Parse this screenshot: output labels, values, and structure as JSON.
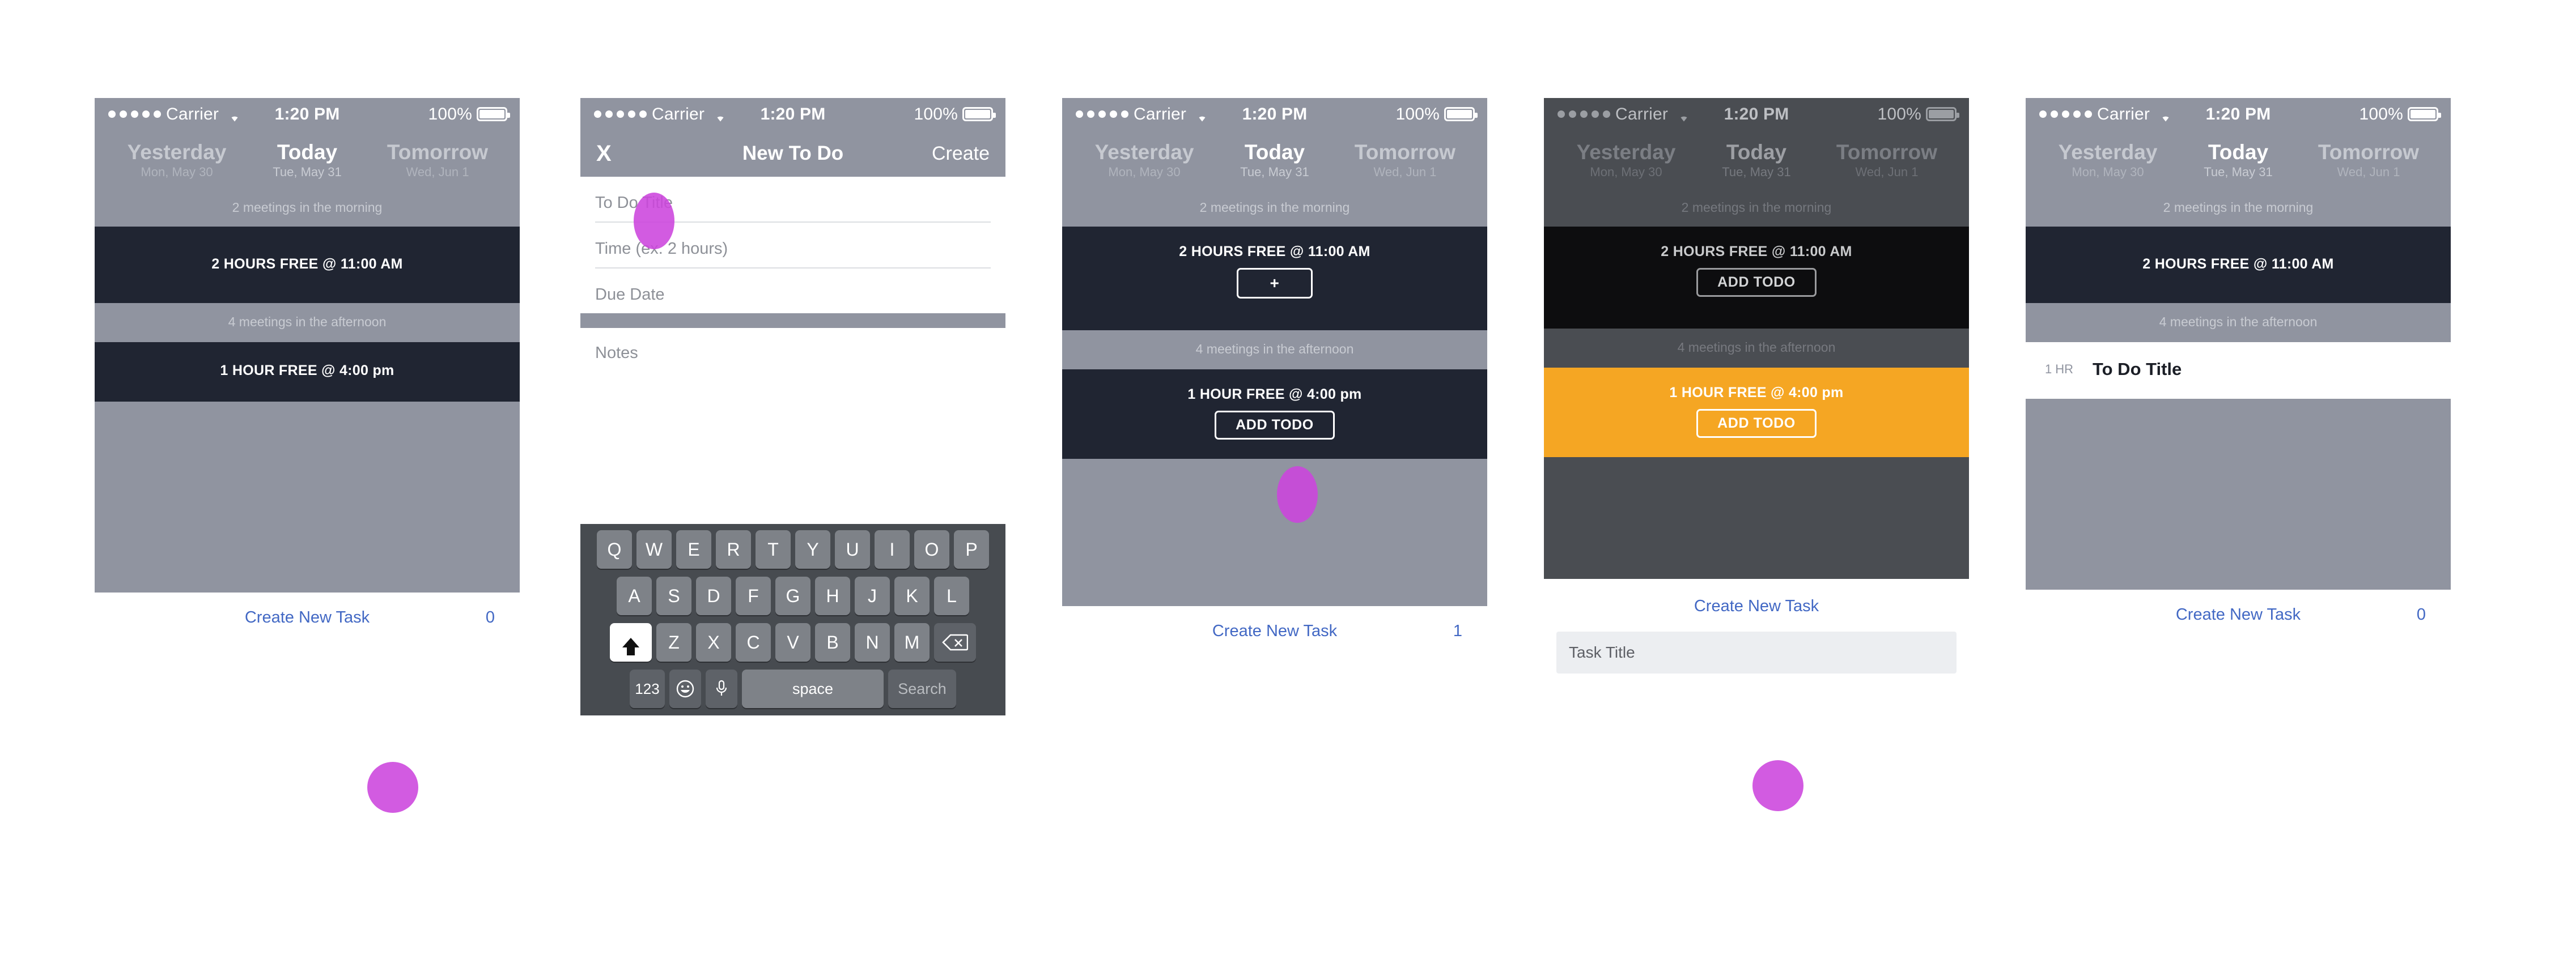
{
  "status_bar": {
    "carrier": "Carrier",
    "signal_dots": 5,
    "wifi_icon": "wifi-icon",
    "time": "1:20 PM",
    "battery_percent": "100%",
    "battery_icon": "battery-full-icon"
  },
  "days": [
    {
      "name": "Yesterday",
      "sub": "Mon, May 30",
      "active": false
    },
    {
      "name": "Today",
      "sub": "Tue, May 31",
      "active": true
    },
    {
      "name": "Tomorrow",
      "sub": "Wed, Jun 1",
      "active": false
    }
  ],
  "schedule": {
    "morning_summary": "2 meetings in the morning",
    "afternoon_summary": "4 meetings in the afternoon",
    "morning_free": "2 HOURS FREE @ 11:00 AM",
    "afternoon_free": "1 HOUR FREE @ 4:00 pm"
  },
  "buttons": {
    "add_todo": "ADD TODO",
    "plus": "+",
    "create_new_task": "Create New Task"
  },
  "counts": {
    "zero": "0",
    "one": "1"
  },
  "screen2": {
    "nav": {
      "close_icon": "close-icon",
      "close_label": "X",
      "title": "New To Do",
      "action": "Create"
    },
    "fields": [
      {
        "placeholder": "To Do Title"
      },
      {
        "placeholder": "Time (ex. 2 hours)"
      },
      {
        "placeholder": "Due Date"
      }
    ],
    "notes_placeholder": "Notes",
    "keyboard": {
      "row1": [
        "Q",
        "W",
        "E",
        "R",
        "T",
        "Y",
        "U",
        "I",
        "O",
        "P"
      ],
      "row2": [
        "A",
        "S",
        "D",
        "F",
        "G",
        "H",
        "J",
        "K",
        "L"
      ],
      "row3": [
        "Z",
        "X",
        "C",
        "V",
        "B",
        "N",
        "M"
      ],
      "shift_icon": "shift-icon",
      "delete_icon": "backspace-icon",
      "numbers_key": "123",
      "emoji_icon": "emoji-icon",
      "mic_icon": "microphone-icon",
      "space_key": "space",
      "search_key": "Search"
    }
  },
  "screen4": {
    "create_new_task": "Create New Task",
    "task_title_placeholder": "Task Title"
  },
  "screen5": {
    "todo_duration": "1 HR",
    "todo_title": "To Do Title"
  },
  "colors": {
    "header_gray": "#9094a0",
    "slot_dark": "#202532",
    "accent_orange": "#f5a623",
    "link_blue": "#4268c4",
    "touch_magenta": "#cc44dd",
    "keyboard_bg": "#474b50"
  }
}
